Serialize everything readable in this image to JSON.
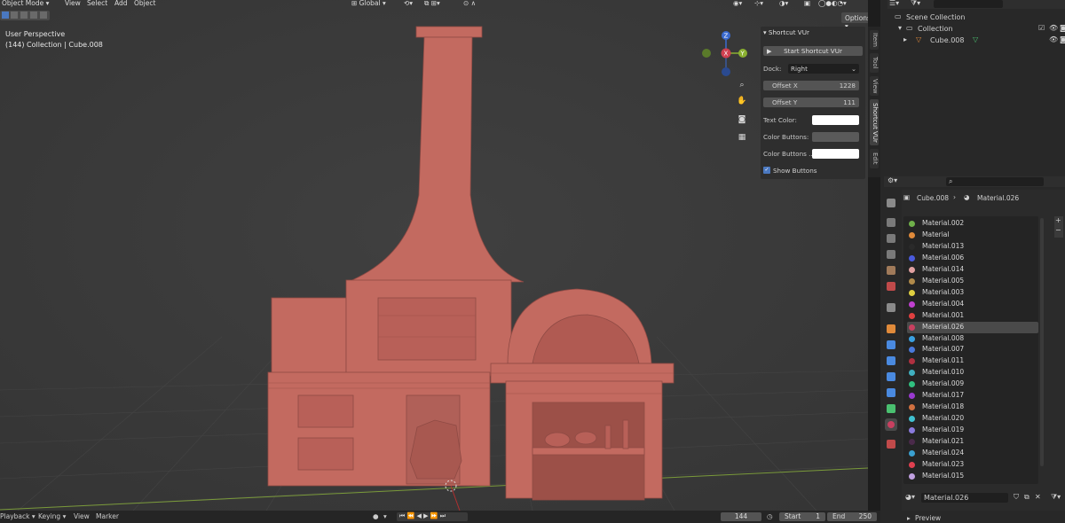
{
  "header": {
    "mode": "Object Mode",
    "menus": [
      "View",
      "Select",
      "Add",
      "Object"
    ],
    "transform_orientation": "Global",
    "options": "Options"
  },
  "viewport": {
    "perspective": "User Perspective",
    "collection_info": "(144) Collection | Cube.008"
  },
  "shortcut_panel": {
    "title": "Shortcut VUr",
    "start_button": "Start Shortcut VUr",
    "dock_label": "Dock:",
    "dock_value": "Right",
    "offset_x_label": "Offset X",
    "offset_x_value": "1228",
    "offset_y_label": "Offset Y",
    "offset_y_value": "111",
    "text_color_label": "Text Color:",
    "color_buttons_label": "Color Buttons:",
    "color_buttons2_label": "Color Buttons ...",
    "show_buttons_label": "Show Buttons",
    "text_color": "#ffffff",
    "color_buttons": "#5a5a5a",
    "color_buttons2": "#ffffff"
  },
  "side_tabs": [
    "Item",
    "Tool",
    "View",
    "Shortcut VUr",
    "Edit"
  ],
  "outliner": {
    "scene_collection": "Scene Collection",
    "collection": "Collection",
    "object": "Cube.008"
  },
  "properties": {
    "object": "Cube.008",
    "material": "Material.026",
    "materials": [
      {
        "name": "Material.002",
        "color": "#6fb04a"
      },
      {
        "name": "Material",
        "color": "#e08a3a"
      },
      {
        "name": "Material.013",
        "color": "#2a2a2a"
      },
      {
        "name": "Material.006",
        "color": "#4a5adc"
      },
      {
        "name": "Material.014",
        "color": "#e0a0a0"
      },
      {
        "name": "Material.005",
        "color": "#b08a4a"
      },
      {
        "name": "Material.003",
        "color": "#e0d040"
      },
      {
        "name": "Material.004",
        "color": "#c040d0"
      },
      {
        "name": "Material.001",
        "color": "#e04040"
      },
      {
        "name": "Material.026",
        "color": "#c84060"
      },
      {
        "name": "Material.008",
        "color": "#3aa0e0"
      },
      {
        "name": "Material.007",
        "color": "#4a7adc"
      },
      {
        "name": "Material.011",
        "color": "#b03040"
      },
      {
        "name": "Material.010",
        "color": "#40b0c0"
      },
      {
        "name": "Material.009",
        "color": "#30c080"
      },
      {
        "name": "Material.017",
        "color": "#9a3ad0"
      },
      {
        "name": "Material.018",
        "color": "#d07040"
      },
      {
        "name": "Material.020",
        "color": "#40c0d0"
      },
      {
        "name": "Material.019",
        "color": "#8a7adc"
      },
      {
        "name": "Material.021",
        "color": "#4a2a4a"
      },
      {
        "name": "Material.024",
        "color": "#3aa0d0"
      },
      {
        "name": "Material.023",
        "color": "#e04050"
      },
      {
        "name": "Material.015",
        "color": "#c0a0e0"
      }
    ],
    "selected_index": 9,
    "preview": "Preview"
  },
  "timeline": {
    "playback": "Playback",
    "keying": "Keying",
    "view": "View",
    "marker": "Marker",
    "current_frame": "144",
    "start_label": "Start",
    "start_value": "1",
    "end_label": "End",
    "end_value": "250"
  },
  "gizmo": {
    "z": "Z",
    "x": "X",
    "y": "Y"
  }
}
